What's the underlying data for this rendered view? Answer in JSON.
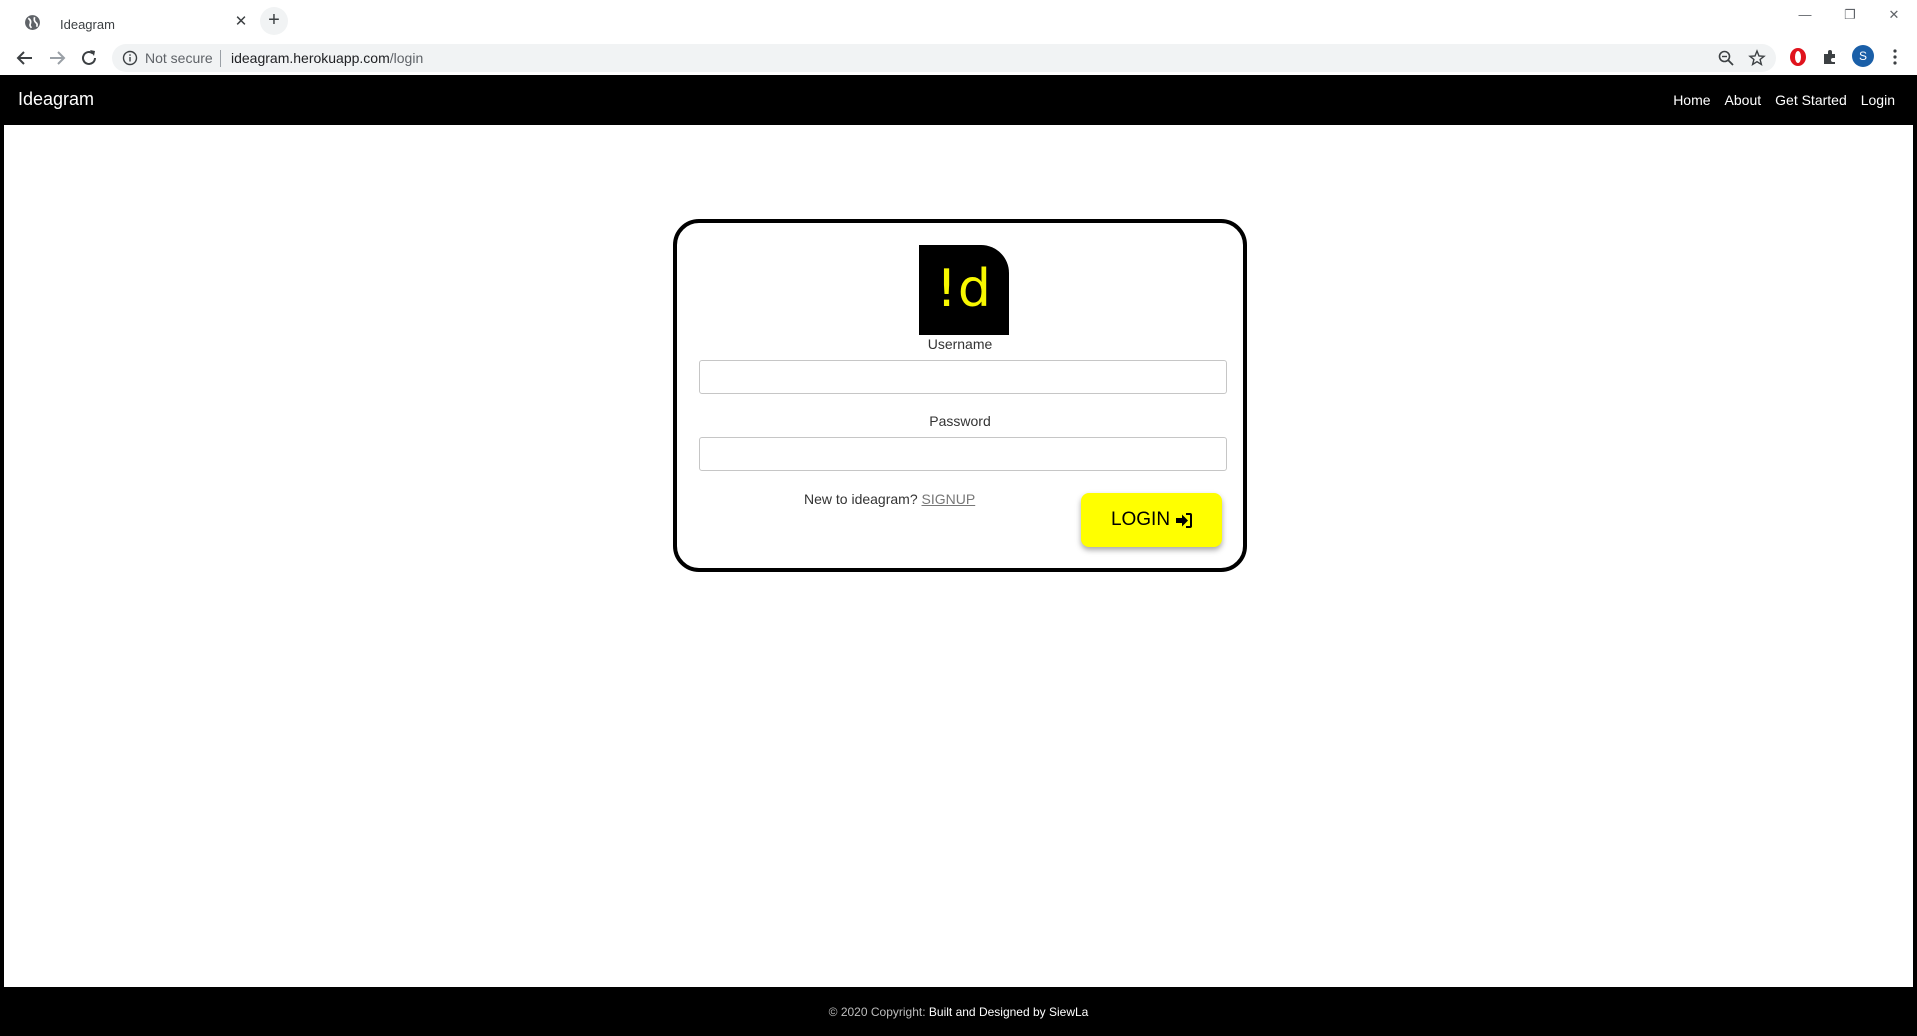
{
  "browser": {
    "tab_title": "Ideagram",
    "tab_close": "✕",
    "new_tab": "+",
    "window_controls": {
      "minimize": "—",
      "restore": "❐",
      "close": "✕"
    },
    "security_label": "Not secure",
    "url_host": "ideagram.herokuapp.com",
    "url_path": "/login",
    "profile_initial": "S"
  },
  "navbar": {
    "brand": "Ideagram",
    "links": [
      "Home",
      "About",
      "Get Started",
      "Login"
    ]
  },
  "login_form": {
    "logo_text": "!d",
    "username_label": "Username",
    "username_value": "",
    "password_label": "Password",
    "password_value": "",
    "signup_prompt": "New to ideagram?",
    "signup_link": "SIGNUP",
    "login_button": "LOGIN"
  },
  "footer": {
    "copyright": "© 2020 Copyright:",
    "credit": "Built and Designed by SiewLa"
  },
  "colors": {
    "accent_yellow": "#ffff00",
    "logo_yellow": "#f7f700",
    "nav_background": "#000000",
    "profile_blue": "#1a5fa8"
  }
}
